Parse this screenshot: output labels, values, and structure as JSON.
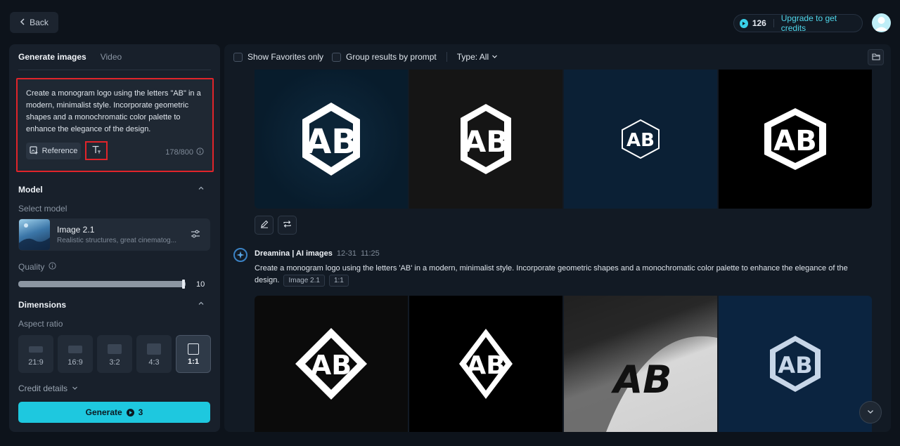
{
  "topbar": {
    "back_label": "Back",
    "credits_count": "126",
    "upgrade_label": "Upgrade to get credits"
  },
  "left": {
    "tabs": [
      {
        "label": "Generate images",
        "active": true
      },
      {
        "label": "Video",
        "active": false
      }
    ],
    "prompt": {
      "text": "Create a monogram logo using the letters \"AB\" in a modern, minimalist style. Incorporate geometric shapes and a monochromatic color palette to enhance the elegance of the design.",
      "reference_label": "Reference",
      "counter": "178/800"
    },
    "model": {
      "title": "Model",
      "select_label": "Select model",
      "name": "Image 2.1",
      "description": "Realistic structures, great cinematog..."
    },
    "quality": {
      "label": "Quality",
      "value": "10",
      "fraction": 1.0
    },
    "dimensions": {
      "title": "Dimensions",
      "aspect_label": "Aspect ratio",
      "ratios": [
        {
          "label": "21:9",
          "active": false
        },
        {
          "label": "16:9",
          "active": false
        },
        {
          "label": "3:2",
          "active": false
        },
        {
          "label": "4:3",
          "active": false
        },
        {
          "label": "1:1",
          "active": true
        }
      ]
    },
    "credit_details_label": "Credit details",
    "generate": {
      "label": "Generate",
      "cost": "3"
    }
  },
  "right": {
    "toolbar": {
      "favorites_label": "Show Favorites only",
      "group_label": "Group results by prompt",
      "type_label": "Type: All"
    },
    "row1_logos": [
      "AB",
      "AB",
      "AB",
      "AB"
    ],
    "generation": {
      "source": "Dreamina | AI images",
      "date": "12-31",
      "time": "11:25",
      "prompt": "Create a monogram logo using the letters 'AB' in a modern, minimalist style. Incorporate geometric shapes and a monochromatic color palette to enhance the elegance of the design.",
      "model_tag": "Image 2.1",
      "ratio_tag": "1:1"
    },
    "row2_logos": [
      "AB",
      "AB",
      "AB",
      "AB"
    ]
  },
  "colors": {
    "accent": "#1ec8df",
    "highlight_border": "#e0242a",
    "background": "#0d131b"
  }
}
